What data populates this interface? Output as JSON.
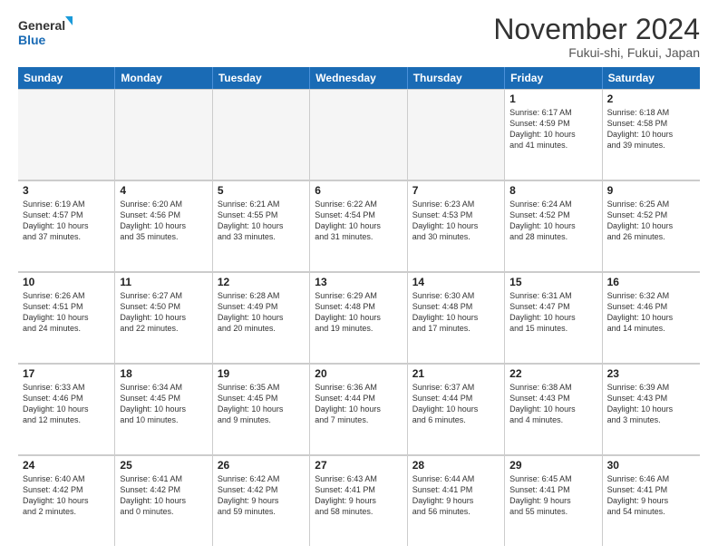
{
  "logo": {
    "line1": "General",
    "line2": "Blue"
  },
  "title": "November 2024",
  "location": "Fukui-shi, Fukui, Japan",
  "weekdays": [
    "Sunday",
    "Monday",
    "Tuesday",
    "Wednesday",
    "Thursday",
    "Friday",
    "Saturday"
  ],
  "weeks": [
    [
      {
        "day": "",
        "info": "",
        "empty": true
      },
      {
        "day": "",
        "info": "",
        "empty": true
      },
      {
        "day": "",
        "info": "",
        "empty": true
      },
      {
        "day": "",
        "info": "",
        "empty": true
      },
      {
        "day": "",
        "info": "",
        "empty": true
      },
      {
        "day": "1",
        "info": "Sunrise: 6:17 AM\nSunset: 4:59 PM\nDaylight: 10 hours\nand 41 minutes."
      },
      {
        "day": "2",
        "info": "Sunrise: 6:18 AM\nSunset: 4:58 PM\nDaylight: 10 hours\nand 39 minutes."
      }
    ],
    [
      {
        "day": "3",
        "info": "Sunrise: 6:19 AM\nSunset: 4:57 PM\nDaylight: 10 hours\nand 37 minutes."
      },
      {
        "day": "4",
        "info": "Sunrise: 6:20 AM\nSunset: 4:56 PM\nDaylight: 10 hours\nand 35 minutes."
      },
      {
        "day": "5",
        "info": "Sunrise: 6:21 AM\nSunset: 4:55 PM\nDaylight: 10 hours\nand 33 minutes."
      },
      {
        "day": "6",
        "info": "Sunrise: 6:22 AM\nSunset: 4:54 PM\nDaylight: 10 hours\nand 31 minutes."
      },
      {
        "day": "7",
        "info": "Sunrise: 6:23 AM\nSunset: 4:53 PM\nDaylight: 10 hours\nand 30 minutes."
      },
      {
        "day": "8",
        "info": "Sunrise: 6:24 AM\nSunset: 4:52 PM\nDaylight: 10 hours\nand 28 minutes."
      },
      {
        "day": "9",
        "info": "Sunrise: 6:25 AM\nSunset: 4:52 PM\nDaylight: 10 hours\nand 26 minutes."
      }
    ],
    [
      {
        "day": "10",
        "info": "Sunrise: 6:26 AM\nSunset: 4:51 PM\nDaylight: 10 hours\nand 24 minutes."
      },
      {
        "day": "11",
        "info": "Sunrise: 6:27 AM\nSunset: 4:50 PM\nDaylight: 10 hours\nand 22 minutes."
      },
      {
        "day": "12",
        "info": "Sunrise: 6:28 AM\nSunset: 4:49 PM\nDaylight: 10 hours\nand 20 minutes."
      },
      {
        "day": "13",
        "info": "Sunrise: 6:29 AM\nSunset: 4:48 PM\nDaylight: 10 hours\nand 19 minutes."
      },
      {
        "day": "14",
        "info": "Sunrise: 6:30 AM\nSunset: 4:48 PM\nDaylight: 10 hours\nand 17 minutes."
      },
      {
        "day": "15",
        "info": "Sunrise: 6:31 AM\nSunset: 4:47 PM\nDaylight: 10 hours\nand 15 minutes."
      },
      {
        "day": "16",
        "info": "Sunrise: 6:32 AM\nSunset: 4:46 PM\nDaylight: 10 hours\nand 14 minutes."
      }
    ],
    [
      {
        "day": "17",
        "info": "Sunrise: 6:33 AM\nSunset: 4:46 PM\nDaylight: 10 hours\nand 12 minutes."
      },
      {
        "day": "18",
        "info": "Sunrise: 6:34 AM\nSunset: 4:45 PM\nDaylight: 10 hours\nand 10 minutes."
      },
      {
        "day": "19",
        "info": "Sunrise: 6:35 AM\nSunset: 4:45 PM\nDaylight: 10 hours\nand 9 minutes."
      },
      {
        "day": "20",
        "info": "Sunrise: 6:36 AM\nSunset: 4:44 PM\nDaylight: 10 hours\nand 7 minutes."
      },
      {
        "day": "21",
        "info": "Sunrise: 6:37 AM\nSunset: 4:44 PM\nDaylight: 10 hours\nand 6 minutes."
      },
      {
        "day": "22",
        "info": "Sunrise: 6:38 AM\nSunset: 4:43 PM\nDaylight: 10 hours\nand 4 minutes."
      },
      {
        "day": "23",
        "info": "Sunrise: 6:39 AM\nSunset: 4:43 PM\nDaylight: 10 hours\nand 3 minutes."
      }
    ],
    [
      {
        "day": "24",
        "info": "Sunrise: 6:40 AM\nSunset: 4:42 PM\nDaylight: 10 hours\nand 2 minutes."
      },
      {
        "day": "25",
        "info": "Sunrise: 6:41 AM\nSunset: 4:42 PM\nDaylight: 10 hours\nand 0 minutes."
      },
      {
        "day": "26",
        "info": "Sunrise: 6:42 AM\nSunset: 4:42 PM\nDaylight: 9 hours\nand 59 minutes."
      },
      {
        "day": "27",
        "info": "Sunrise: 6:43 AM\nSunset: 4:41 PM\nDaylight: 9 hours\nand 58 minutes."
      },
      {
        "day": "28",
        "info": "Sunrise: 6:44 AM\nSunset: 4:41 PM\nDaylight: 9 hours\nand 56 minutes."
      },
      {
        "day": "29",
        "info": "Sunrise: 6:45 AM\nSunset: 4:41 PM\nDaylight: 9 hours\nand 55 minutes."
      },
      {
        "day": "30",
        "info": "Sunrise: 6:46 AM\nSunset: 4:41 PM\nDaylight: 9 hours\nand 54 minutes."
      }
    ]
  ]
}
